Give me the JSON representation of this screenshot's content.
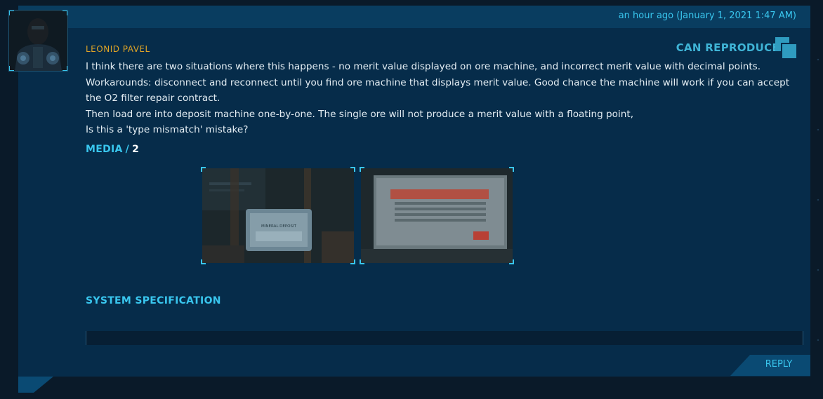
{
  "header": {
    "timestamp": "an hour ago (January 1, 2021 1:47 AM)"
  },
  "comment": {
    "author": "LEONID PAVEL",
    "status": "CAN REPRODUCE",
    "body": [
      "I think there are two situations where this happens - no merit value displayed on ore machine, and incorrect merit value with decimal points.",
      "Workarounds: disconnect and reconnect until you find ore machine that displays merit value. Good chance the machine will work if you can accept the O2 filter repair contract.",
      "Then load ore into deposit machine one-by-one. The single ore will not produce a merit value with a floating point,",
      "Is this a 'type mismatch' mistake?"
    ]
  },
  "media": {
    "label": "MEDIA",
    "separator": "/",
    "count": "2",
    "thumbnails": [
      {
        "icon": "screenshot-mineral-deposit",
        "caption": "MINERAL DEPOSIT"
      },
      {
        "icon": "screenshot-terminal-screen"
      }
    ]
  },
  "system_spec": {
    "label": "SYSTEM SPECIFICATION"
  },
  "actions": {
    "reply": "REPLY"
  },
  "colors": {
    "accent": "#39c6ee",
    "author": "#e0a526",
    "card_bg": "#062c4a",
    "header_bg": "#093d60"
  }
}
